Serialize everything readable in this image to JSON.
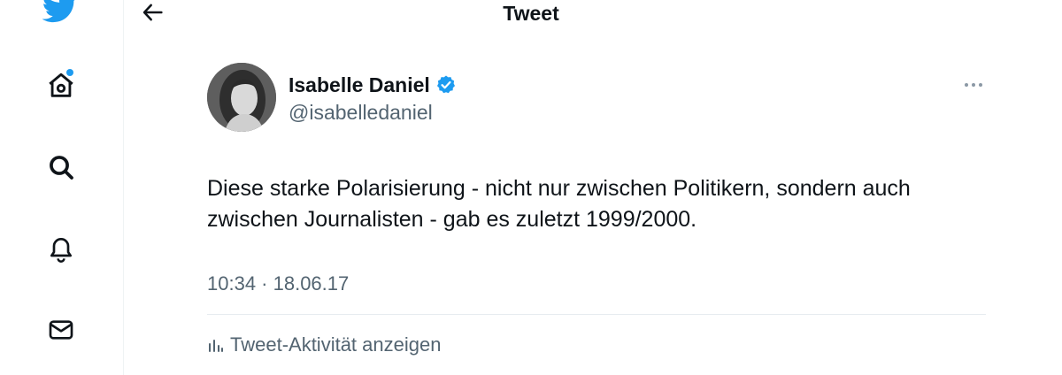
{
  "header": {
    "title": "Tweet"
  },
  "nav": {
    "items": [
      {
        "icon": "twitter-bird-icon"
      },
      {
        "icon": "home-icon",
        "has_notification_dot": true
      },
      {
        "icon": "search-icon"
      },
      {
        "icon": "bell-icon"
      },
      {
        "icon": "mail-icon"
      }
    ]
  },
  "tweet": {
    "author_name": "Isabelle Daniel",
    "author_handle": "@isabelledaniel",
    "verified": true,
    "text_lines": [
      "Diese starke Polarisierung - nicht nur zwischen Politikern, sondern auch",
      "zwischen Journalisten - gab es zuletzt 1999/2000."
    ],
    "timestamp": "10:34 · 18.06.17",
    "activity_label": "Tweet-Aktivität anzeigen"
  },
  "colors": {
    "accent": "#1d9bf0",
    "text_primary": "#0f1419",
    "text_secondary": "#536471"
  }
}
